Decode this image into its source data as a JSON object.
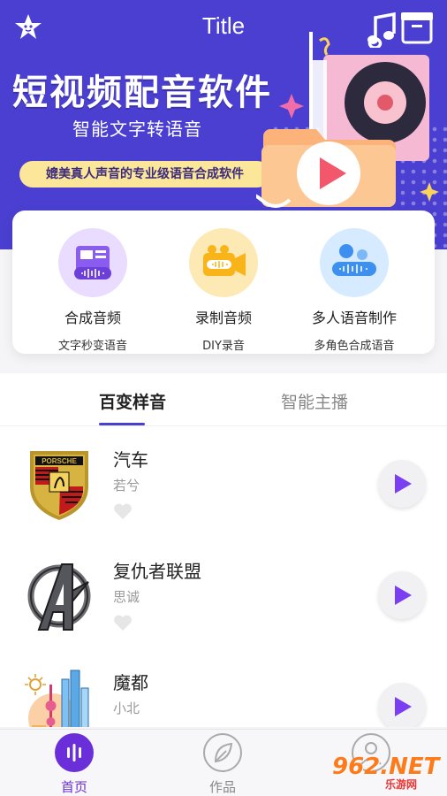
{
  "header": {
    "title": "Title",
    "star_icon": "star-icon",
    "music_icon": "music-note-icon",
    "headline": "短视频配音软件",
    "subline": "智能文字转语音",
    "pill": "媲美真人声音的专业级语音合成软件"
  },
  "features": [
    {
      "name": "合成音频",
      "desc": "文字秒变语音",
      "icon": "synth-device-icon",
      "color": "#e9dcff"
    },
    {
      "name": "录制音频",
      "desc": "DIY录音",
      "icon": "video-camera-icon",
      "color": "#fde9b3"
    },
    {
      "name": "多人语音制作",
      "desc": "多角色合成语音",
      "icon": "multi-voice-icon",
      "color": "#d6ebff"
    }
  ],
  "tabs": [
    {
      "label": "百变样音",
      "active": true
    },
    {
      "label": "智能主播",
      "active": false
    }
  ],
  "voices": [
    {
      "name": "汽车",
      "author": "若兮",
      "logo": "porsche-logo"
    },
    {
      "name": "复仇者联盟",
      "author": "思诚",
      "logo": "avengers-logo"
    },
    {
      "name": "魔都",
      "author": "小北",
      "logo": "shanghai-skyline"
    }
  ],
  "nav": [
    {
      "label": "首页",
      "active": true
    },
    {
      "label": "作品",
      "active": false
    },
    {
      "label": "我的",
      "active": false
    }
  ],
  "watermark": {
    "main": "962.NET",
    "sub": "乐游网"
  },
  "colors": {
    "brand": "#4a3fd1",
    "accent": "#7b3ff2",
    "pill": "#fbe69a"
  }
}
